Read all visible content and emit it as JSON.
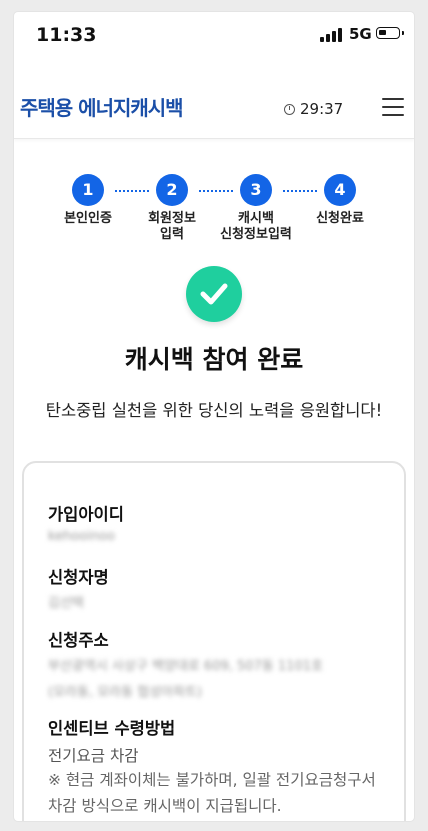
{
  "status_bar": {
    "time": "11:33",
    "network": "5G"
  },
  "header": {
    "logo": "주택용 에너지캐시백",
    "timer": "29:37"
  },
  "steps": [
    {
      "num": "1",
      "label": "본인인증"
    },
    {
      "num": "2",
      "label": "회원정보\n입력"
    },
    {
      "num": "3",
      "label": "캐시백\n신청정보입력"
    },
    {
      "num": "4",
      "label": "신청완료"
    }
  ],
  "completion": {
    "title": "캐시백 참여 완료",
    "subtitle": "탄소중립 실천을 위한 당신의 노력을 응원합니다!"
  },
  "card": {
    "id_label": "가입아이디",
    "id_value": "kehooinoo",
    "name_label": "신청자명",
    "name_value": "김선택",
    "address_label": "신청주소",
    "address_line1": "부산광역시 사상구 백양대로 609, 507동 1101호",
    "address_line2": "(모라동, 모라동 협성아파트)",
    "method_label": "인센티브 수령방법",
    "method_value": "전기요금 차감",
    "method_note": "※ 현금 계좌이체는 불가하며, 일괄 전기요금청구서 차감 방식으로 캐시백이 지급됩니다."
  },
  "colors": {
    "brand": "#1b4fa8",
    "step": "#1365e6",
    "check": "#1fcf9e"
  }
}
